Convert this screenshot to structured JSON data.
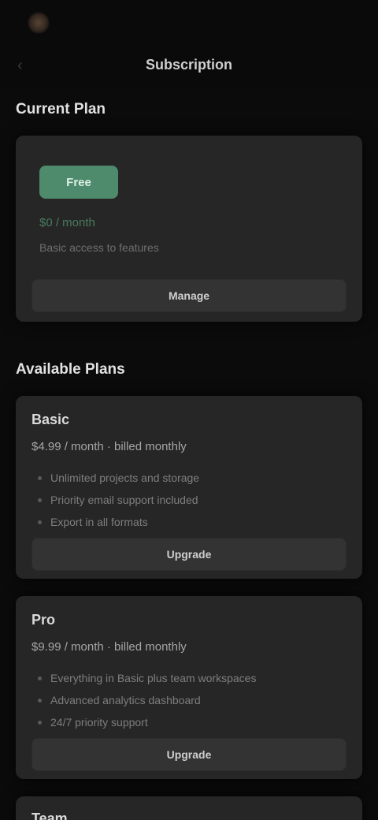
{
  "header": {
    "app_name": "",
    "title": "Subscription",
    "back_icon": "arrow-left-icon"
  },
  "current_plan": {
    "section_title": "Current Plan",
    "badge": "Free",
    "price": "$0 / month",
    "note": "Basic access to features",
    "button_label": "Manage"
  },
  "available_plans": {
    "section_title": "Available Plans",
    "plans": [
      {
        "name": "Basic",
        "price_line": "$4.99 / month · billed monthly",
        "features": [
          "Unlimited projects and storage",
          "Priority email support included",
          "Export in all formats"
        ],
        "button_label": "Upgrade"
      },
      {
        "name": "Pro",
        "price_line": "$9.99 / month · billed monthly",
        "features": [
          "Everything in Basic plus team workspaces",
          "Advanced analytics dashboard",
          "24/7 priority support"
        ],
        "button_label": "Upgrade"
      },
      {
        "name": "Team"
      }
    ]
  },
  "colors": {
    "background": "#0b0b0b",
    "card": "#262626",
    "accent_green": "#4e8a6c"
  }
}
